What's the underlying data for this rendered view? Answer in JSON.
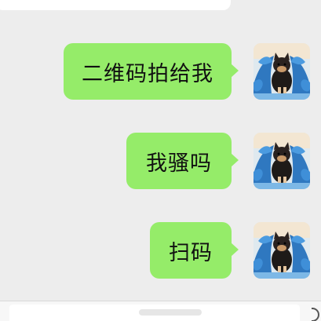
{
  "conversation": {
    "messages": [
      {
        "sender": "self",
        "text": "二维码拍给我"
      },
      {
        "sender": "self",
        "text": "我骚吗"
      },
      {
        "sender": "self",
        "text": "扫码"
      }
    ]
  },
  "avatar": {
    "icon": "shiba-inu-avatar-icon"
  },
  "colors": {
    "background": "#ededed",
    "outgoing_bubble": "#95ec69",
    "text": "#111111"
  }
}
